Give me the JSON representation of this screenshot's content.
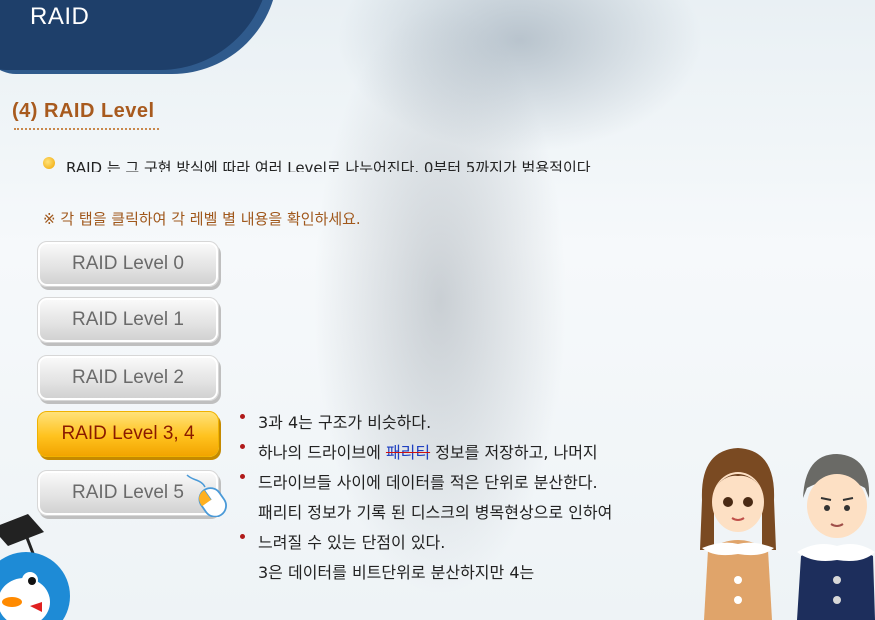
{
  "header": {
    "title": "RAID"
  },
  "section": {
    "title": "(4) RAID Level",
    "intro": "RAID 는 그 구현 방식에 따라 여러 Level로 나누어진다. 0부터 5까지가 범용적이다",
    "notice": "※ 각 탭을 클릭하여 각 레벨 별 내용을 확인하세요."
  },
  "tabs": [
    {
      "label": "RAID Level 0",
      "active": false
    },
    {
      "label": "RAID Level 1",
      "active": false
    },
    {
      "label": "RAID Level 2",
      "active": false
    },
    {
      "label": "RAID Level 3, 4",
      "active": true
    },
    {
      "label": "RAID Level 5",
      "active": false
    }
  ],
  "content": {
    "line1": "3과 4는 구조가 비슷하다.",
    "line2_pre": "하나의 드라이브에 ",
    "line2_strike": "패리티",
    "line2_post": " 정보를 저장하고, 나머지",
    "line3": "드라이브들 사이에 데이터를 적은 단위로 분산한다.",
    "line4": "패리티 정보가 기록 된 디스크의 병목현상으로 인하여",
    "line5": "느려질 수 있는 단점이 있다.",
    "line6": "3은 데이터를 비트단위로 분산하지만 4는"
  },
  "colors": {
    "header_bg": "#1e3f6a",
    "title_color": "#a85a1e",
    "active_tab": "#ffc21e",
    "bullet_red": "#b01a1a"
  },
  "icons": [
    "bullet-icon",
    "mouse-cursor-icon",
    "graduation-penguin-icon",
    "girl-character",
    "man-character"
  ]
}
